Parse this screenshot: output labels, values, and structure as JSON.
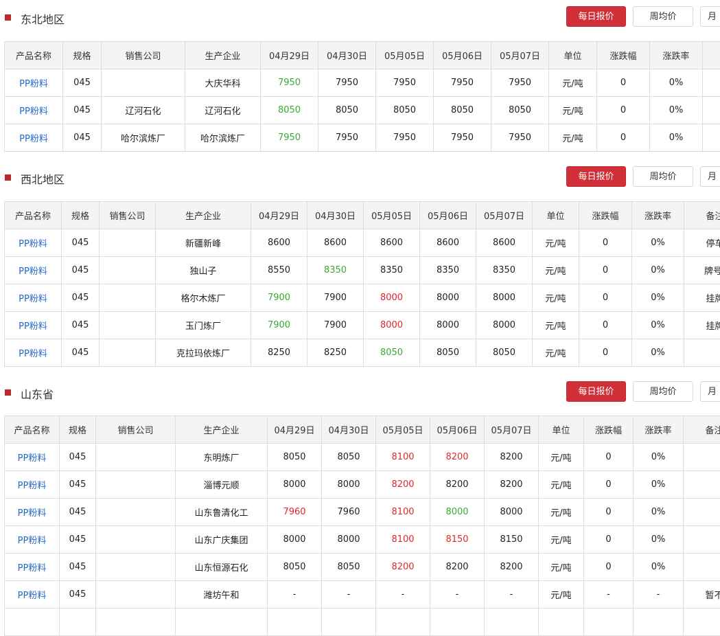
{
  "buttons": {
    "daily": "每日报价",
    "weekly": "周均价",
    "monthly": "月"
  },
  "colors": {
    "accent": "#d12f37",
    "up": "#e0262c",
    "down": "#3aa935",
    "link": "#2468c9"
  },
  "sections": [
    {
      "title": "东北地区",
      "headers": [
        "产品名称",
        "规格",
        "销售公司",
        "生产企业",
        "04月29日",
        "04月30日",
        "05月05日",
        "05月06日",
        "05月07日",
        "单位",
        "涨跌幅",
        "涨跌率",
        ""
      ],
      "rows": [
        {
          "cells": [
            "PP粉料",
            "045",
            "",
            "大庆华科",
            "7950",
            "7950",
            "7950",
            "7950",
            "7950",
            "元/吨",
            "0",
            "0%",
            ""
          ],
          "trend": {
            "4": "down"
          }
        },
        {
          "cells": [
            "PP粉料",
            "045",
            "辽河石化",
            "辽河石化",
            "8050",
            "8050",
            "8050",
            "8050",
            "8050",
            "元/吨",
            "0",
            "0%",
            ""
          ],
          "trend": {
            "4": "down"
          }
        },
        {
          "cells": [
            "PP粉料",
            "045",
            "哈尔滨炼厂",
            "哈尔滨炼厂",
            "7950",
            "7950",
            "7950",
            "7950",
            "7950",
            "元/吨",
            "0",
            "0%",
            ""
          ],
          "trend": {
            "4": "down"
          }
        }
      ]
    },
    {
      "title": "西北地区",
      "headers": [
        "产品名称",
        "规格",
        "销售公司",
        "生产企业",
        "04月29日",
        "04月30日",
        "05月05日",
        "05月06日",
        "05月07日",
        "单位",
        "涨跌幅",
        "涨跌率",
        "备注"
      ],
      "rows": [
        {
          "cells": [
            "PP粉料",
            "045",
            "",
            "新疆新峰",
            "8600",
            "8600",
            "8600",
            "8600",
            "8600",
            "元/吨",
            "0",
            "0%",
            "停车"
          ],
          "trend": {}
        },
        {
          "cells": [
            "PP粉料",
            "045",
            "",
            "独山子",
            "8550",
            "8350",
            "8350",
            "8350",
            "8350",
            "元/吨",
            "0",
            "0%",
            "牌号("
          ],
          "trend": {
            "5": "down"
          }
        },
        {
          "cells": [
            "PP粉料",
            "045",
            "",
            "格尔木炼厂",
            "7900",
            "7900",
            "8000",
            "8000",
            "8000",
            "元/吨",
            "0",
            "0%",
            "挂牌"
          ],
          "trend": {
            "4": "down",
            "6": "up"
          }
        },
        {
          "cells": [
            "PP粉料",
            "045",
            "",
            "玉门炼厂",
            "7900",
            "7900",
            "8000",
            "8000",
            "8000",
            "元/吨",
            "0",
            "0%",
            "挂牌"
          ],
          "trend": {
            "4": "down",
            "6": "up"
          }
        },
        {
          "cells": [
            "PP粉料",
            "045",
            "",
            "克拉玛依炼厂",
            "8250",
            "8250",
            "8050",
            "8050",
            "8050",
            "元/吨",
            "0",
            "0%",
            ""
          ],
          "trend": {
            "6": "down"
          }
        }
      ]
    },
    {
      "title": "山东省",
      "headers": [
        "产品名称",
        "规格",
        "销售公司",
        "生产企业",
        "04月29日",
        "04月30日",
        "05月05日",
        "05月06日",
        "05月07日",
        "单位",
        "涨跌幅",
        "涨跌率",
        "备注"
      ],
      "rows": [
        {
          "cells": [
            "PP粉料",
            "045",
            "",
            "东明炼厂",
            "8050",
            "8050",
            "8100",
            "8200",
            "8200",
            "元/吨",
            "0",
            "0%",
            ""
          ],
          "trend": {
            "6": "up",
            "7": "up"
          }
        },
        {
          "cells": [
            "PP粉料",
            "045",
            "",
            "淄博元顺",
            "8000",
            "8000",
            "8200",
            "8200",
            "8200",
            "元/吨",
            "0",
            "0%",
            ""
          ],
          "trend": {
            "6": "up"
          }
        },
        {
          "cells": [
            "PP粉料",
            "045",
            "",
            "山东鲁清化工",
            "7960",
            "7960",
            "8100",
            "8000",
            "8000",
            "元/吨",
            "0",
            "0%",
            ""
          ],
          "trend": {
            "4": "up",
            "6": "up",
            "7": "down"
          }
        },
        {
          "cells": [
            "PP粉料",
            "045",
            "",
            "山东广庆集团",
            "8000",
            "8000",
            "8100",
            "8150",
            "8150",
            "元/吨",
            "0",
            "0%",
            ""
          ],
          "trend": {
            "6": "up",
            "7": "up"
          }
        },
        {
          "cells": [
            "PP粉料",
            "045",
            "",
            "山东恒源石化",
            "8050",
            "8050",
            "8200",
            "8200",
            "8200",
            "元/吨",
            "0",
            "0%",
            ""
          ],
          "trend": {
            "6": "up"
          }
        },
        {
          "cells": [
            "PP粉料",
            "045",
            "",
            "潍坊午和",
            "-",
            "-",
            "-",
            "-",
            "-",
            "元/吨",
            "-",
            "-",
            "暂不"
          ],
          "trend": {}
        },
        {
          "cells": [
            "",
            "",
            "",
            "",
            "",
            "",
            "",
            "",
            "",
            "",
            "",
            "",
            ""
          ],
          "trend": {}
        }
      ]
    }
  ]
}
